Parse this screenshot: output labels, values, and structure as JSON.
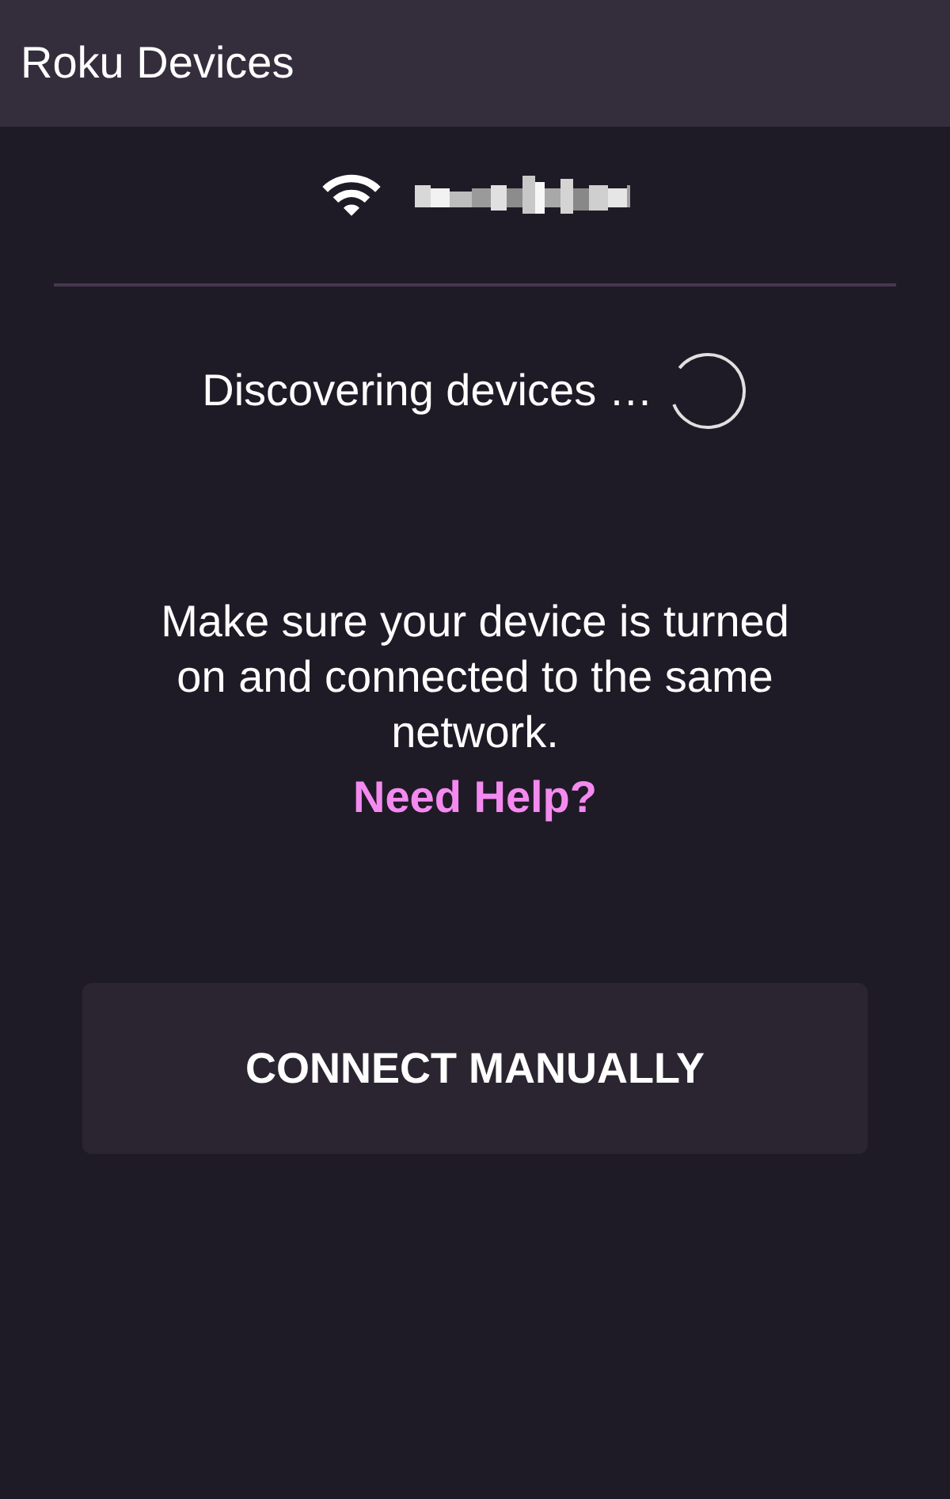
{
  "app_bar": {
    "title": "Roku Devices"
  },
  "discovery": {
    "status": "Discovering devices …",
    "searching": true
  },
  "hint": {
    "message": "Make sure your device is turned on and connected to the same network.",
    "help_link": "Need Help?"
  },
  "actions": [
    {
      "label": "CONNECT MANUALLY"
    }
  ]
}
